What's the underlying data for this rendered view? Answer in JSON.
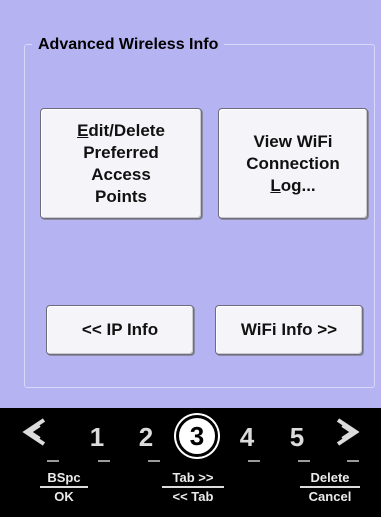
{
  "group": {
    "title": "Advanced Wireless Info"
  },
  "buttons": {
    "edit_delete": {
      "mnemonic": "E",
      "line1_rest": "dit/Delete",
      "line2": "Preferred",
      "line3": "Access",
      "line4": "Points"
    },
    "view_log": {
      "line1": "View WiFi",
      "line2": "Connection",
      "mnemonic": "L",
      "line3_rest": "og..."
    },
    "ip_info": "<< IP Info",
    "wifi_info": "WiFi Info >>"
  },
  "softbar": {
    "left_arrow_icon": "chevron-left-icon",
    "right_arrow_icon": "chevron-right-icon",
    "numbers": [
      "1",
      "2",
      "3",
      "4",
      "5"
    ],
    "selected": "3",
    "keys": {
      "left": {
        "top": "BSpc",
        "bottom": "OK"
      },
      "middle": {
        "top": "Tab >>",
        "bottom": "<< Tab"
      },
      "right": {
        "top": "Delete",
        "bottom": "Cancel"
      }
    }
  },
  "colors": {
    "panel": "#b6b3f2",
    "button_face": "#f5f5f9",
    "softbar": "#000000"
  }
}
